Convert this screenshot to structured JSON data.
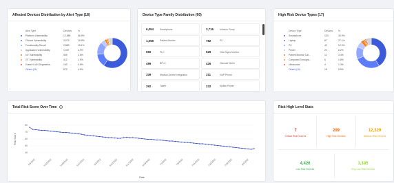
{
  "alert_type_card": {
    "title": "Affected Devices Distribution by Alert Type (18)",
    "col_alert_type": "Alert Type",
    "col_devices": "Devices",
    "col_percent": "%",
    "rows": [
      {
        "label": "Platform Vulnerability",
        "devices": "12,885",
        "percent": "66.9%",
        "color": "#3b5bdb"
      },
      {
        "label": "Clinical Vulnerability",
        "devices": "3,073",
        "percent": "15.9%",
        "color": "#5c7cfa"
      },
      {
        "label": "Functionality Recall",
        "devices": "2,883",
        "percent": "15.1%",
        "color": "#91a7ff"
      },
      {
        "label": "Application Vulnerability",
        "devices": "1,067",
        "percent": "4.9%",
        "color": "#bac8ff"
      },
      {
        "label": "IoT Vulnerability",
        "devices": "509",
        "percent": "2.6%",
        "color": "#fd7e14"
      },
      {
        "label": "OT Vulnerability",
        "devices": "412",
        "percent": "1.9%",
        "color": "#ff922b"
      },
      {
        "label": "Guest VLAN Segmenta...",
        "devices": "163",
        "percent": "0.8%",
        "color": "#fa5252"
      }
    ],
    "others_label": "Others (11)",
    "others_devices": "870",
    "others_percent": "4.5%"
  },
  "family_card": {
    "title": "Device Type Family Distribution (60)",
    "cells": [
      {
        "count": "6,054",
        "label": "Smartphone"
      },
      {
        "count": "3,716",
        "label": "Infusion Pump"
      },
      {
        "count": "1,058",
        "label": "Patient Monitor"
      },
      {
        "count": "782",
        "label": "PC"
      },
      {
        "count": "550",
        "label": "PLC"
      },
      {
        "count": "529",
        "label": "Vital Signs Monitor"
      },
      {
        "count": "499",
        "label": "BPLC"
      },
      {
        "count": "426",
        "label": "Glucose Meter"
      },
      {
        "count": "339",
        "label": "Medical Device Integration"
      },
      {
        "count": "311",
        "label": "VoIP Phone"
      },
      {
        "count": "292",
        "label": "Tablet"
      },
      {
        "count": "232",
        "label": "Mobile Printer"
      }
    ]
  },
  "high_risk_card": {
    "title": "High Risk Device Types (17)",
    "col_type": "Device Type",
    "col_devices": "Devices",
    "col_percent": "%",
    "rows": [
      {
        "label": "Smartphone",
        "devices": "133",
        "percent": "40.9%",
        "color": "#3b5bdb"
      },
      {
        "label": "Laptop",
        "devices": "87",
        "percent": "27.1%",
        "color": "#5c7cfa"
      },
      {
        "label": "PC",
        "devices": "42",
        "percent": "12.9%",
        "color": "#91a7ff"
      },
      {
        "label": "Printer",
        "devices": "22",
        "percent": "6.2%",
        "color": "#bac8ff"
      },
      {
        "label": "Patient Monitor Cal...",
        "devices": "11",
        "percent": "3.4%",
        "color": "#fd7e14"
      },
      {
        "label": "Computed Tomogra...",
        "devices": "6",
        "percent": "1.8%",
        "color": "#ff922b"
      },
      {
        "label": "Ultrasound",
        "devices": "4",
        "percent": "1.3%",
        "color": "#fa5252"
      }
    ],
    "others_label": "Others (10)",
    "others_devices": "18",
    "others_percent": "5.5%"
  },
  "risk_score_card": {
    "title": "Total Risk Score Over Time",
    "info_icon": "info-icon"
  },
  "chart_data": {
    "type": "line",
    "title": "Total Risk Score Over Time",
    "xlabel": "Date",
    "ylabel": "Risk Score",
    "y_ticks": [
      "80",
      "70",
      "60",
      "50",
      "40"
    ],
    "ylim": [
      35,
      85
    ],
    "x_tick_labels": [
      "5/6/2022",
      "5/13/2022",
      "5/20/2022",
      "5/27/2022",
      "6/3/2022",
      "6/10/2022",
      "6/17/2022",
      "6/24/2022",
      "7/1/2022",
      "7/8/2022",
      "7/15/2022",
      "7/22/2022",
      "7/29/2022",
      "8/5/2022"
    ],
    "series": [
      {
        "color": "#3b4fbf",
        "values": [
          77,
          74,
          73.5,
          73,
          72.5,
          72.5,
          72,
          71.5,
          71,
          70.5,
          70,
          69.5,
          69.5,
          69,
          68.5,
          68,
          67.5,
          67,
          66,
          65.5,
          65,
          64.5,
          64,
          63.5,
          63,
          62.5,
          62,
          62,
          61.5,
          61,
          61,
          62,
          62.5,
          62,
          62,
          61.5,
          61,
          60.5,
          60,
          59.5,
          59.5,
          59,
          58.5,
          58.5,
          58,
          57.5,
          57,
          57,
          56.5,
          56,
          55.5,
          55,
          55,
          54.5,
          54,
          53.5,
          53,
          53,
          52.5,
          52,
          51.5,
          51,
          50.5,
          50,
          49.5,
          49,
          48.5,
          48,
          47.5,
          47,
          46.5,
          46,
          45.5,
          45,
          46
        ]
      }
    ]
  },
  "risk_level_card": {
    "title": "Risk High Level Stats",
    "stats": [
      {
        "value": "7",
        "label": "Critical Risk Devices",
        "color": "#e03131"
      },
      {
        "value": "299",
        "label": "High Risk Devices",
        "color": "#f76707"
      },
      {
        "value": "12,329",
        "label": "Medium Risk Devices",
        "color": "#f59f00"
      },
      {
        "value": "4,426",
        "label": "Low Risk Devices",
        "color": "#37b24d"
      },
      {
        "value": "3,185",
        "label": "Very Low Risk Devices",
        "color": "#94d82d"
      }
    ]
  }
}
